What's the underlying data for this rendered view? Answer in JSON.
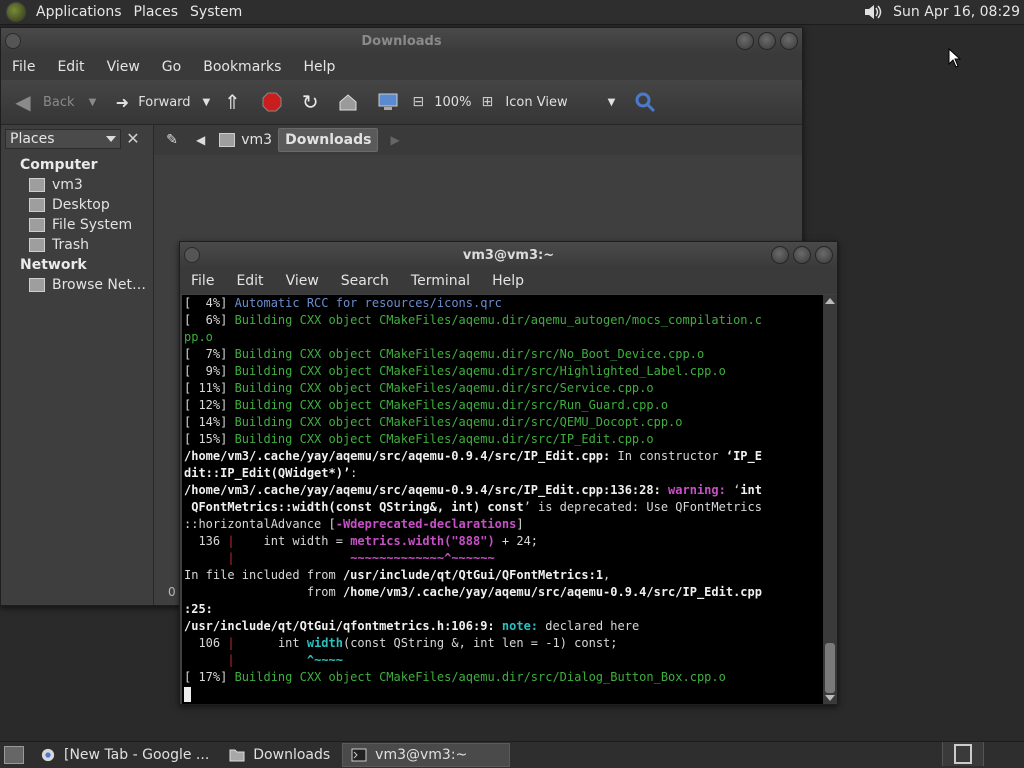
{
  "top_panel": {
    "menus": [
      "Applications",
      "Places",
      "System"
    ],
    "clock": "Sun Apr 16, 08:29"
  },
  "file_manager": {
    "title": "Downloads",
    "menu": [
      "File",
      "Edit",
      "View",
      "Go",
      "Bookmarks",
      "Help"
    ],
    "toolbar": {
      "back": "Back",
      "forward": "Forward",
      "zoom": "100%",
      "view_mode": "Icon View"
    },
    "sidebar": {
      "combo": "Places",
      "computer_heading": "Computer",
      "computer_items": [
        "vm3",
        "Desktop",
        "File System",
        "Trash"
      ],
      "network_heading": "Network",
      "network_items": [
        "Browse Net…"
      ]
    },
    "path": [
      "vm3",
      "Downloads"
    ],
    "status": "0"
  },
  "terminal": {
    "title": "vm3@vm3:~",
    "menu": [
      "File",
      "Edit",
      "View",
      "Search",
      "Terminal",
      "Help"
    ],
    "lines": [
      [
        [
          "c-white",
          "[  4%] "
        ],
        [
          "c-blue",
          "Automatic RCC for resources/icons.qrc"
        ]
      ],
      [
        [
          "c-white",
          "[  6%] "
        ],
        [
          "c-green",
          "Building CXX object CMakeFiles/aqemu.dir/aqemu_autogen/mocs_compilation.c"
        ]
      ],
      [
        [
          "c-green",
          "pp.o"
        ]
      ],
      [
        [
          "c-white",
          "[  7%] "
        ],
        [
          "c-green",
          "Building CXX object CMakeFiles/aqemu.dir/src/No_Boot_Device.cpp.o"
        ]
      ],
      [
        [
          "c-white",
          "[  9%] "
        ],
        [
          "c-green",
          "Building CXX object CMakeFiles/aqemu.dir/src/Highlighted_Label.cpp.o"
        ]
      ],
      [
        [
          "c-white",
          "[ 11%] "
        ],
        [
          "c-green",
          "Building CXX object CMakeFiles/aqemu.dir/src/Service.cpp.o"
        ]
      ],
      [
        [
          "c-white",
          "[ 12%] "
        ],
        [
          "c-green",
          "Building CXX object CMakeFiles/aqemu.dir/src/Run_Guard.cpp.o"
        ]
      ],
      [
        [
          "c-white",
          "[ 14%] "
        ],
        [
          "c-green",
          "Building CXX object CMakeFiles/aqemu.dir/src/QEMU_Docopt.cpp.o"
        ]
      ],
      [
        [
          "c-white",
          "[ 15%] "
        ],
        [
          "c-green",
          "Building CXX object CMakeFiles/aqemu.dir/src/IP_Edit.cpp.o"
        ]
      ],
      [
        [
          "c-bold",
          "/home/vm3/.cache/yay/aqemu/src/aqemu-0.9.4/src/IP_Edit.cpp:"
        ],
        [
          "c-white",
          " In constructor "
        ],
        [
          "c-bold",
          "‘IP_E"
        ]
      ],
      [
        [
          "c-bold",
          "dit::IP_Edit(QWidget*)’"
        ],
        [
          "c-white",
          ":"
        ]
      ],
      [
        [
          "c-bold",
          "/home/vm3/.cache/yay/aqemu/src/aqemu-0.9.4/src/IP_Edit.cpp:136:28:"
        ],
        [
          "c-mag",
          " warning: "
        ],
        [
          "c-white",
          "‘"
        ],
        [
          "c-bold",
          "int"
        ]
      ],
      [
        [
          "c-bold",
          " QFontMetrics::width(const QString&, int) const"
        ],
        [
          "c-white",
          "’ is deprecated: Use QFontMetrics"
        ]
      ],
      [
        [
          "c-white",
          "::horizontalAdvance ["
        ],
        [
          "c-mag",
          "-Wdeprecated-declarations"
        ],
        [
          "c-white",
          "]"
        ]
      ],
      [
        [
          "c-white",
          "  136 "
        ],
        [
          "c-red",
          "|"
        ],
        [
          "c-white",
          "    int width = "
        ],
        [
          "c-mag",
          "metrics.width(\"888\")"
        ],
        [
          "c-white",
          " + 24;"
        ]
      ],
      [
        [
          "c-white",
          "      "
        ],
        [
          "c-red",
          "|"
        ],
        [
          "c-mag",
          "                ~~~~~~~~~~~~~^~~~~~~"
        ]
      ],
      [
        [
          "c-white",
          "In file included from "
        ],
        [
          "c-bold",
          "/usr/include/qt/QtGui/QFontMetrics:1"
        ],
        [
          "c-white",
          ","
        ]
      ],
      [
        [
          "c-white",
          "                 from "
        ],
        [
          "c-bold",
          "/home/vm3/.cache/yay/aqemu/src/aqemu-0.9.4/src/IP_Edit.cpp"
        ]
      ],
      [
        [
          "c-bold",
          ":25:"
        ]
      ],
      [
        [
          "c-bold",
          "/usr/include/qt/QtGui/qfontmetrics.h:106:9:"
        ],
        [
          "c-cyan",
          " note: "
        ],
        [
          "c-white",
          "declared here"
        ]
      ],
      [
        [
          "c-white",
          "  106 "
        ],
        [
          "c-red",
          "|"
        ],
        [
          "c-white",
          "      int "
        ],
        [
          "c-cyan",
          "width"
        ],
        [
          "c-white",
          "(const QString &, int len = -1) const;"
        ]
      ],
      [
        [
          "c-white",
          "      "
        ],
        [
          "c-red",
          "|"
        ],
        [
          "c-cyan",
          "          ^~~~~"
        ]
      ],
      [
        [
          "c-white",
          "[ 17%] "
        ],
        [
          "c-green",
          "Building CXX object CMakeFiles/aqemu.dir/src/Dialog_Button_Box.cpp.o"
        ]
      ]
    ]
  },
  "taskbar": {
    "tasks": [
      "[New Tab - Google ...",
      "Downloads",
      "vm3@vm3:~"
    ],
    "active_index": 2
  },
  "colors": {
    "panel": "#2e2e2e",
    "terminal_bg": "#000000",
    "term_green": "#3fae3f",
    "term_blue": "#6a8ccd"
  }
}
